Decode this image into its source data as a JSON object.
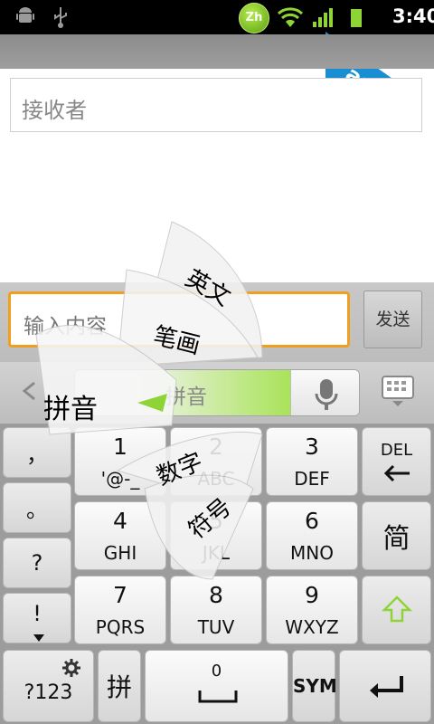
{
  "watermark": "apk8.com",
  "status_bar": {
    "icons": [
      "android-icon",
      "usb-icon",
      "zh-input-icon",
      "wifi-icon",
      "signal-icon",
      "battery-icon"
    ],
    "zh_badge": "Zh",
    "time": "3:40"
  },
  "compose": {
    "recipient_placeholder": "接收者",
    "message_placeholder": "输入内容",
    "send_label": "发送"
  },
  "keyboard": {
    "mode_label": "拼音",
    "fan_menu": [
      "英文",
      "笔画",
      "拼音",
      "数字",
      "符号"
    ],
    "rows": [
      [
        {
          "num": "1",
          "let": "'@-_"
        },
        {
          "num": "2",
          "let": "ABC"
        },
        {
          "num": "3",
          "let": "DEF"
        }
      ],
      [
        {
          "num": "4",
          "let": "GHI"
        },
        {
          "num": "5",
          "let": "JKL"
        },
        {
          "num": "6",
          "let": "MNO"
        }
      ],
      [
        {
          "num": "7",
          "let": "PQRS"
        },
        {
          "num": "8",
          "let": "TUV"
        },
        {
          "num": "9",
          "let": "WXYZ"
        }
      ]
    ],
    "left_column": [
      "，",
      "。",
      "?",
      "!"
    ],
    "del_label": "DEL",
    "jian_label": "简",
    "bottom": {
      "num_switch": "?123",
      "pin_label": "拼",
      "space_num": "0",
      "sym_label": "SYM"
    }
  },
  "colors": {
    "accent_green": "#a9e35a",
    "focus_orange": "#f0a020",
    "watermark_blue": "#1a8ed3"
  }
}
